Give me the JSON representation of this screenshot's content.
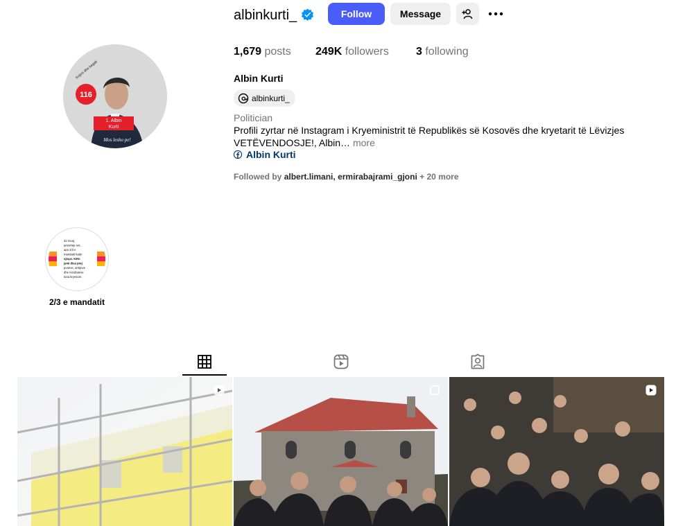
{
  "profile": {
    "username": "albinkurti_",
    "verified": true,
    "follow_label": "Follow",
    "message_label": "Message",
    "posts_count": "1,679",
    "posts_label": "posts",
    "followers_count": "249K",
    "followers_label": "followers",
    "following_count": "3",
    "following_label": "following",
    "full_name": "Albin Kurti",
    "threads_handle": "albinkurti_",
    "category": "Politician",
    "bio_text": "Profili zyrtar në Instagram i Kryeministrit të Republikës së Kosovës dhe kryetarit të Lëvizjes VETËVENDOSJE!, Albin…",
    "bio_more": "more",
    "facebook_link": "Albin Kurti",
    "followed_by_prefix": "Followed by",
    "followed_by_1": "albert.limani",
    "followed_by_sep": ",",
    "followed_by_2": "ermirabajrami_gjoni",
    "followed_by_more": "+ 20 more"
  },
  "avatar_text": {
    "number": "116",
    "line1": "1. Albin",
    "line2": "Kurti",
    "tagline": "Mos lesho pe!",
    "arc": "Krijimi dhe begati"
  },
  "highlights": [
    {
      "label": "2/3 e mandatit",
      "cover_lines": [
        "32 muaj",
        "qeverisje sot,",
        "apo 2/3 e",
        "mandatit katër",
        "vjeçar. Këto",
        "janë disa prej",
        "punëve, arritjeve",
        "dhe rezultateve",
        "tona kryesore."
      ]
    }
  ],
  "tabs": [
    {
      "name": "posts",
      "icon": "grid-icon",
      "active": true
    },
    {
      "name": "reels",
      "icon": "reels-icon",
      "active": false
    },
    {
      "name": "tagged",
      "icon": "tagged-icon",
      "active": false
    }
  ],
  "colors": {
    "follow_button": "#4a5df9",
    "verified": "#0095f6",
    "link": "#00376b",
    "secondary_text": "#737373"
  }
}
